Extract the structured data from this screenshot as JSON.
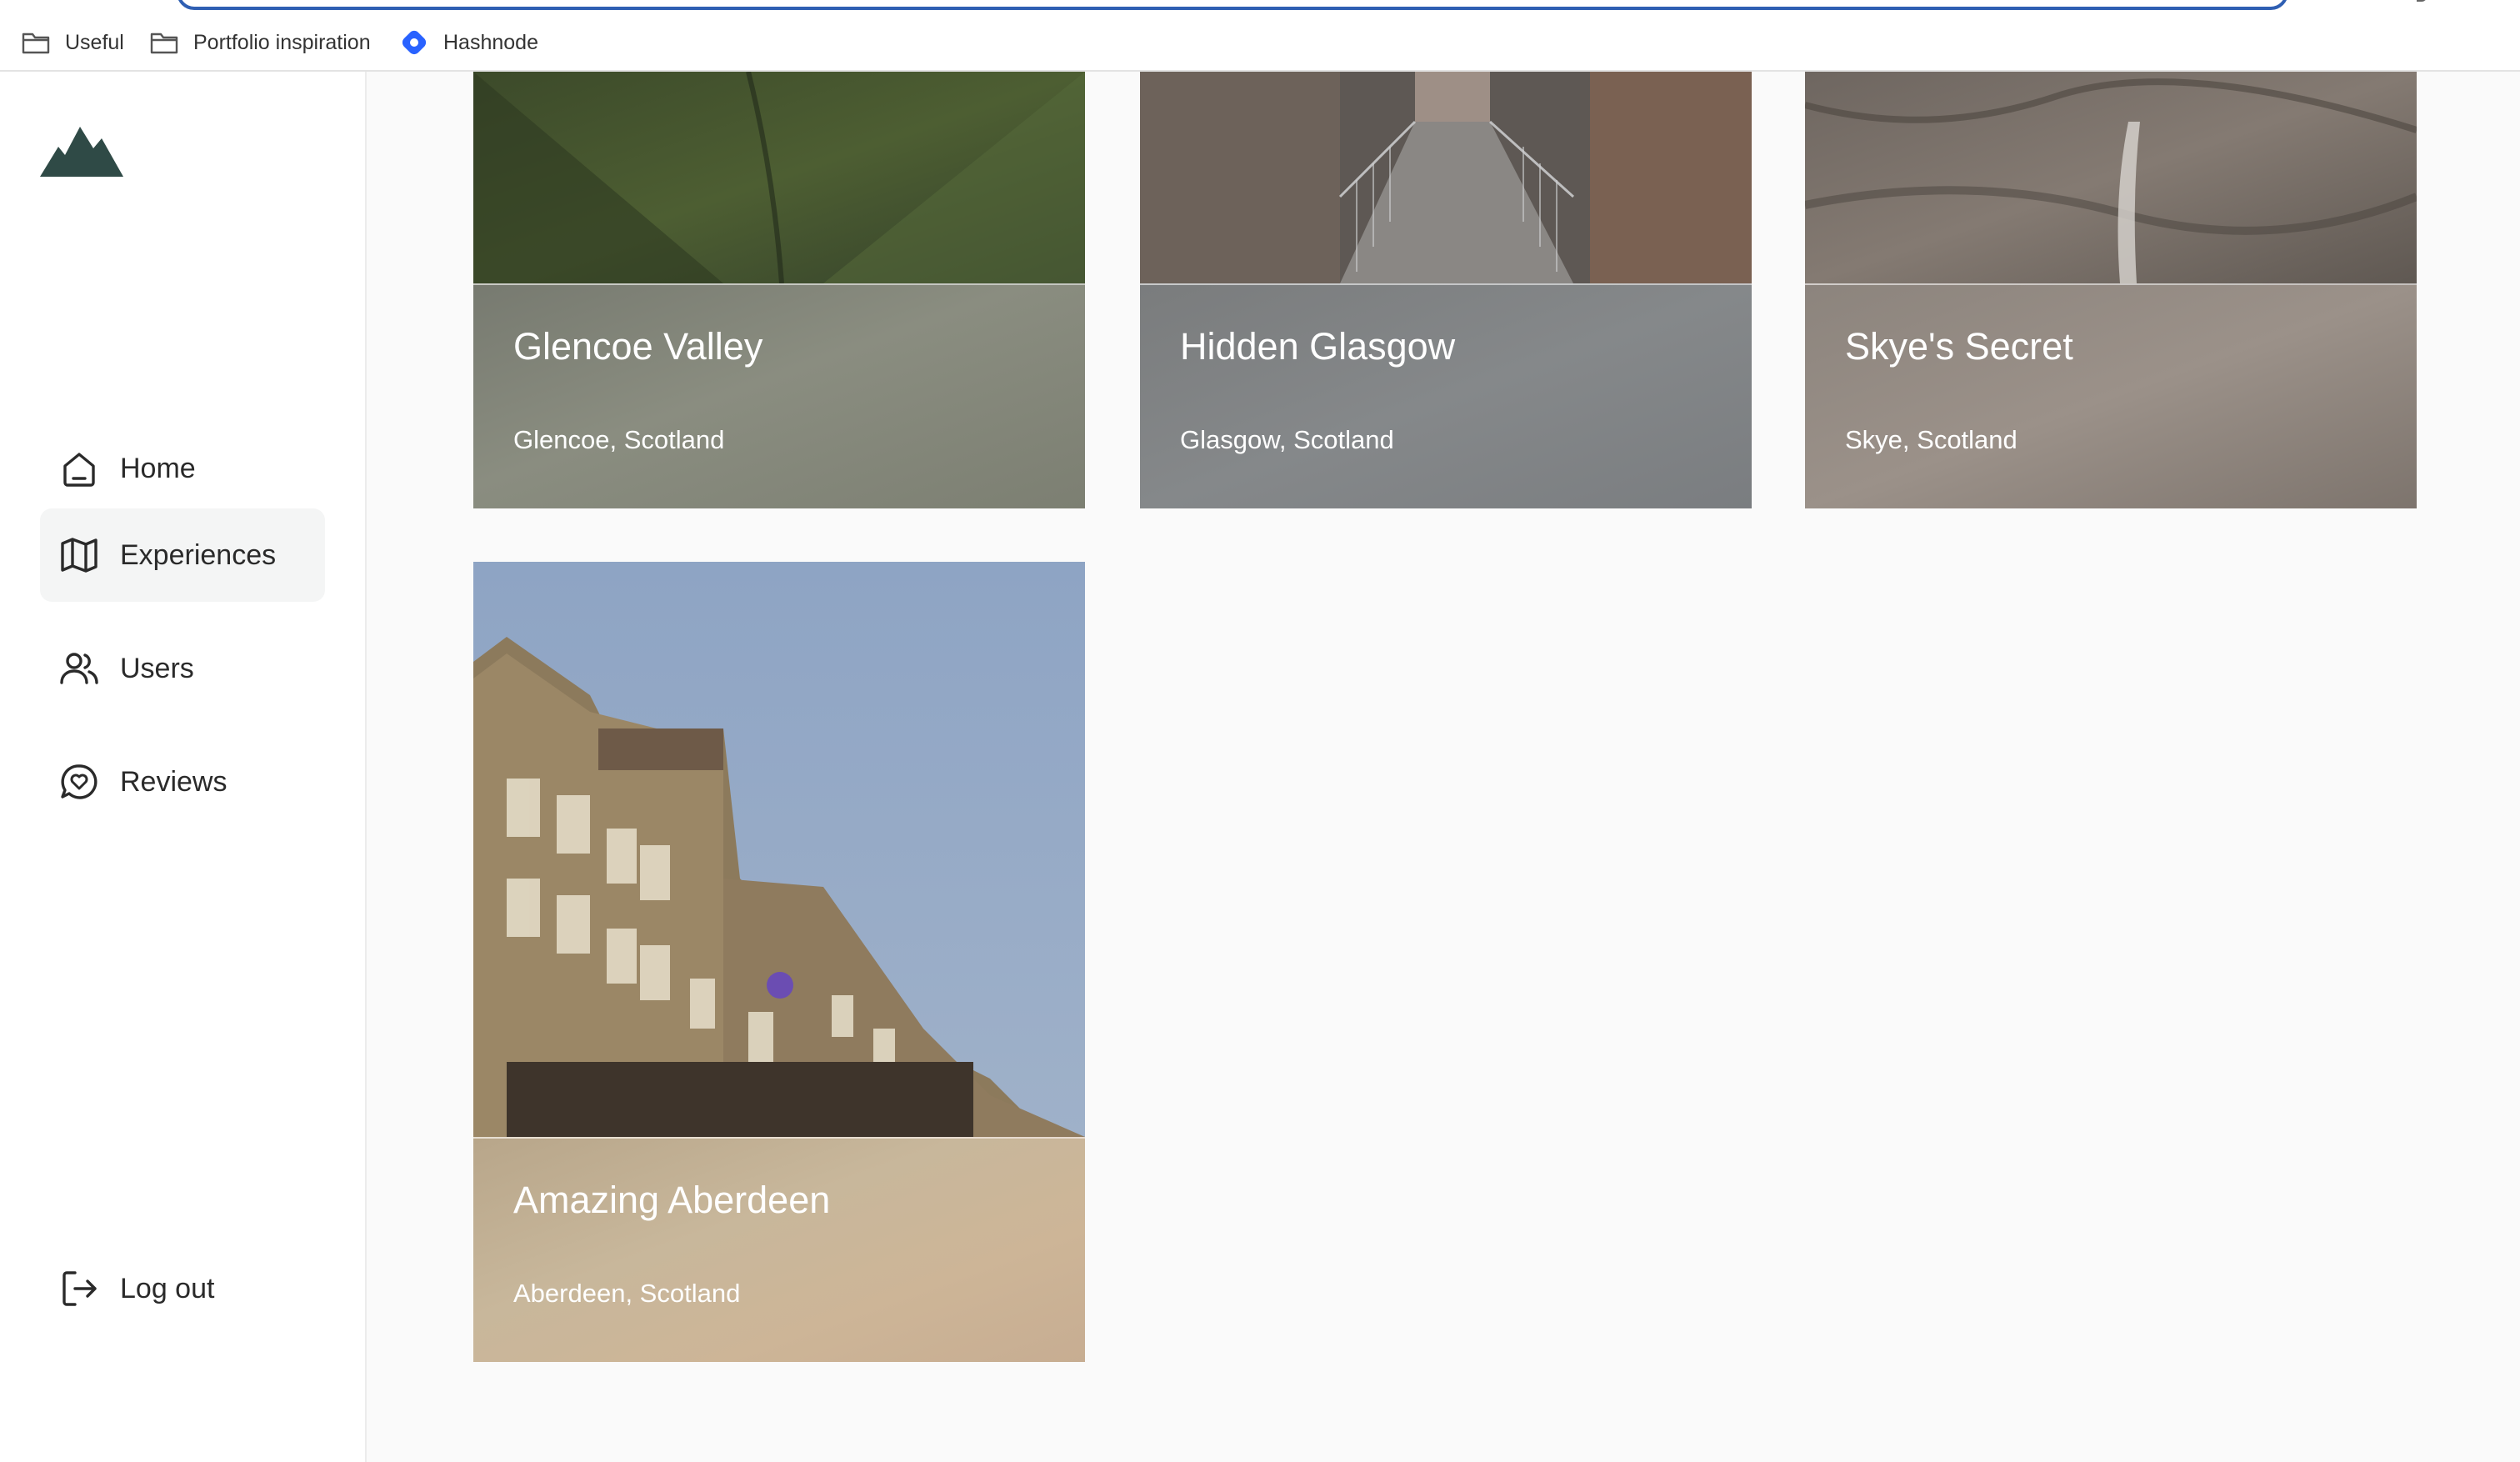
{
  "bookmarks": [
    {
      "icon": "folder-icon",
      "label": "Useful"
    },
    {
      "icon": "folder-icon",
      "label": "Portfolio inspiration"
    },
    {
      "icon": "hashnode-icon",
      "label": "Hashnode"
    }
  ],
  "sidebar": {
    "logo": "mountain-logo",
    "nav": [
      {
        "icon": "home-icon",
        "label": "Home",
        "active": false
      },
      {
        "icon": "map-icon",
        "label": "Experiences",
        "active": true
      },
      {
        "icon": "users-icon",
        "label": "Users",
        "active": false
      },
      {
        "icon": "reviews-icon",
        "label": "Reviews",
        "active": false
      }
    ],
    "logout": {
      "icon": "logout-icon",
      "label": "Log out"
    }
  },
  "experiences": [
    {
      "title": "Glencoe Valley",
      "location": "Glencoe, Scotland"
    },
    {
      "title": "Hidden Glasgow",
      "location": "Glasgow, Scotland"
    },
    {
      "title": "Skye's Secret",
      "location": "Skye, Scotland"
    },
    {
      "title": "Amazing Aberdeen",
      "location": "Aberdeen, Scotland"
    }
  ],
  "colors": {
    "accent": "#2f5fb3",
    "logo": "#2f4a46",
    "active_nav_bg": "#f4f5f5"
  }
}
